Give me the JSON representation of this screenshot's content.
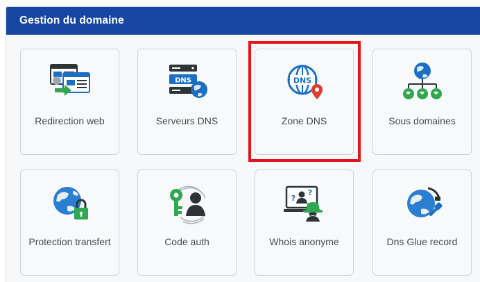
{
  "panel": {
    "title": "Gestion du domaine"
  },
  "tiles": [
    {
      "label": "Redirection web",
      "icon": "web-redirect-icon"
    },
    {
      "label": "Serveurs DNS",
      "icon": "dns-servers-icon"
    },
    {
      "label": "Zone DNS",
      "icon": "dns-zone-icon",
      "selected": true
    },
    {
      "label": "Sous domaines",
      "icon": "subdomains-icon"
    },
    {
      "label": "Protection transfert",
      "icon": "transfer-protection-icon"
    },
    {
      "label": "Code auth",
      "icon": "auth-code-icon"
    },
    {
      "label": "Whois anonyme",
      "icon": "anonymous-whois-icon"
    },
    {
      "label": "Dns Glue record",
      "icon": "dns-glue-record-icon"
    }
  ],
  "colors": {
    "header": "#1746a2",
    "highlight": "#e4141a",
    "icon_blue": "#1a6fc4",
    "icon_green": "#2fa84f",
    "icon_dark": "#2e3338"
  }
}
